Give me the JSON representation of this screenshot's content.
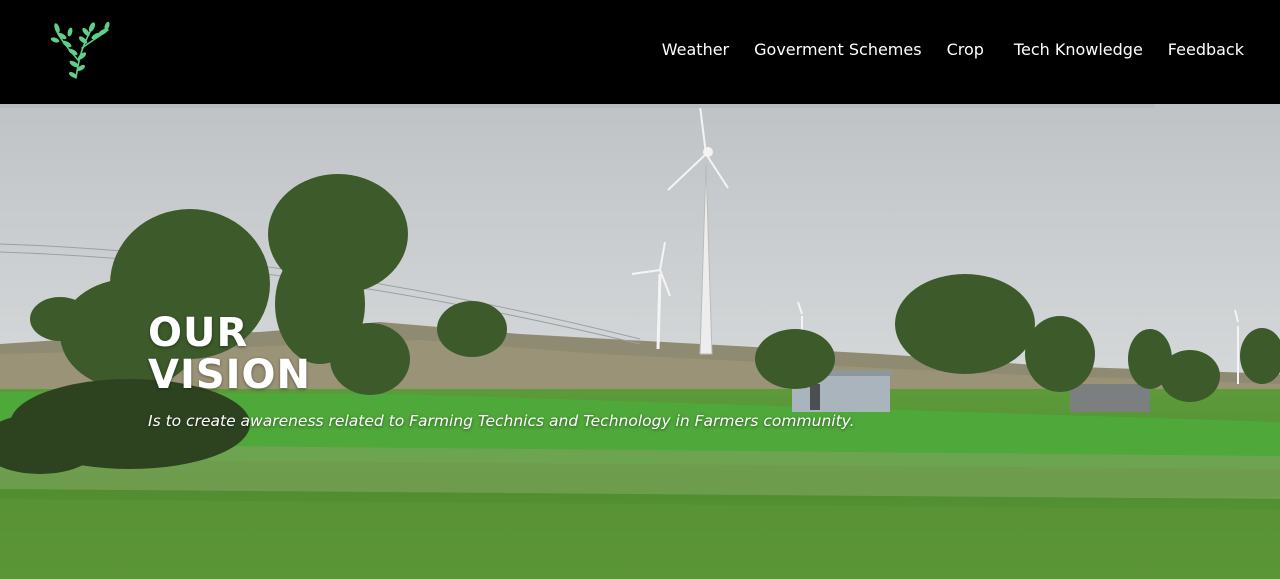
{
  "navbar": {
    "logo_icon": "leaf-branch-icon",
    "items": [
      {
        "label": "Weather"
      },
      {
        "label": "Goverment Schemes"
      },
      {
        "label": "Crop"
      },
      {
        "label": "Tech Knowledge"
      },
      {
        "label": "Feedback"
      }
    ]
  },
  "hero": {
    "title_line1": "OUR",
    "title_line2": "VISION",
    "subtitle": "Is to create awareness related to Farming Technics and Technology in Farmers community."
  },
  "colors": {
    "nav_bg": "#000000",
    "text": "#ffffff",
    "logo_leaf": "#5fd08a",
    "field_green": "#4f8f33",
    "sky": "#c9cdd0"
  }
}
